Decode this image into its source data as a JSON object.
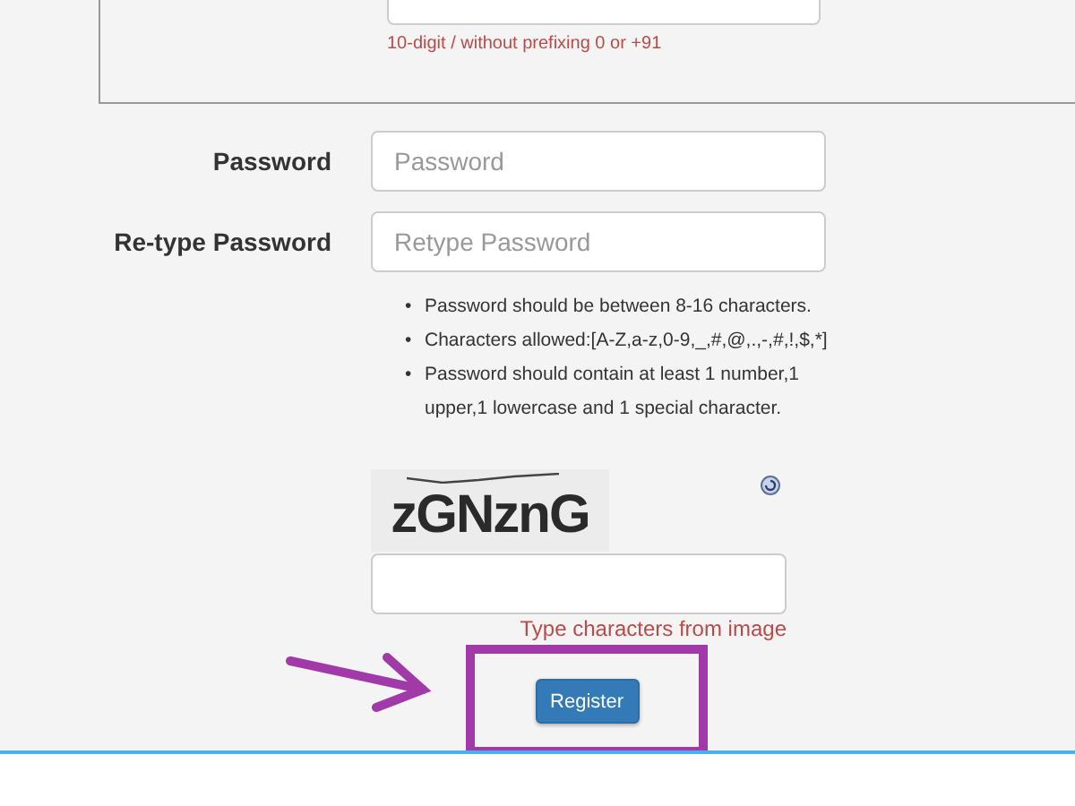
{
  "mobile_hint": "10-digit / without prefixing 0 or +91",
  "fields": [
    {
      "label": "Password",
      "placeholder": "Password"
    },
    {
      "label": "Re-type Password",
      "placeholder": "Retype Password"
    }
  ],
  "rules": [
    {
      "bullet": "•",
      "text": "Password should be between 8-16 characters."
    },
    {
      "bullet": "•",
      "text": "Characters allowed:[A-Z,a-z,0-9,_,#,@,.,-,#,!,$,*]"
    },
    {
      "bullet": "•",
      "text": "Password should contain at least 1 number,1 upper,1 lowercase and 1 special character."
    }
  ],
  "captcha": {
    "code": "zGNznG",
    "hint": "Type characters from image"
  },
  "submit": "Register"
}
